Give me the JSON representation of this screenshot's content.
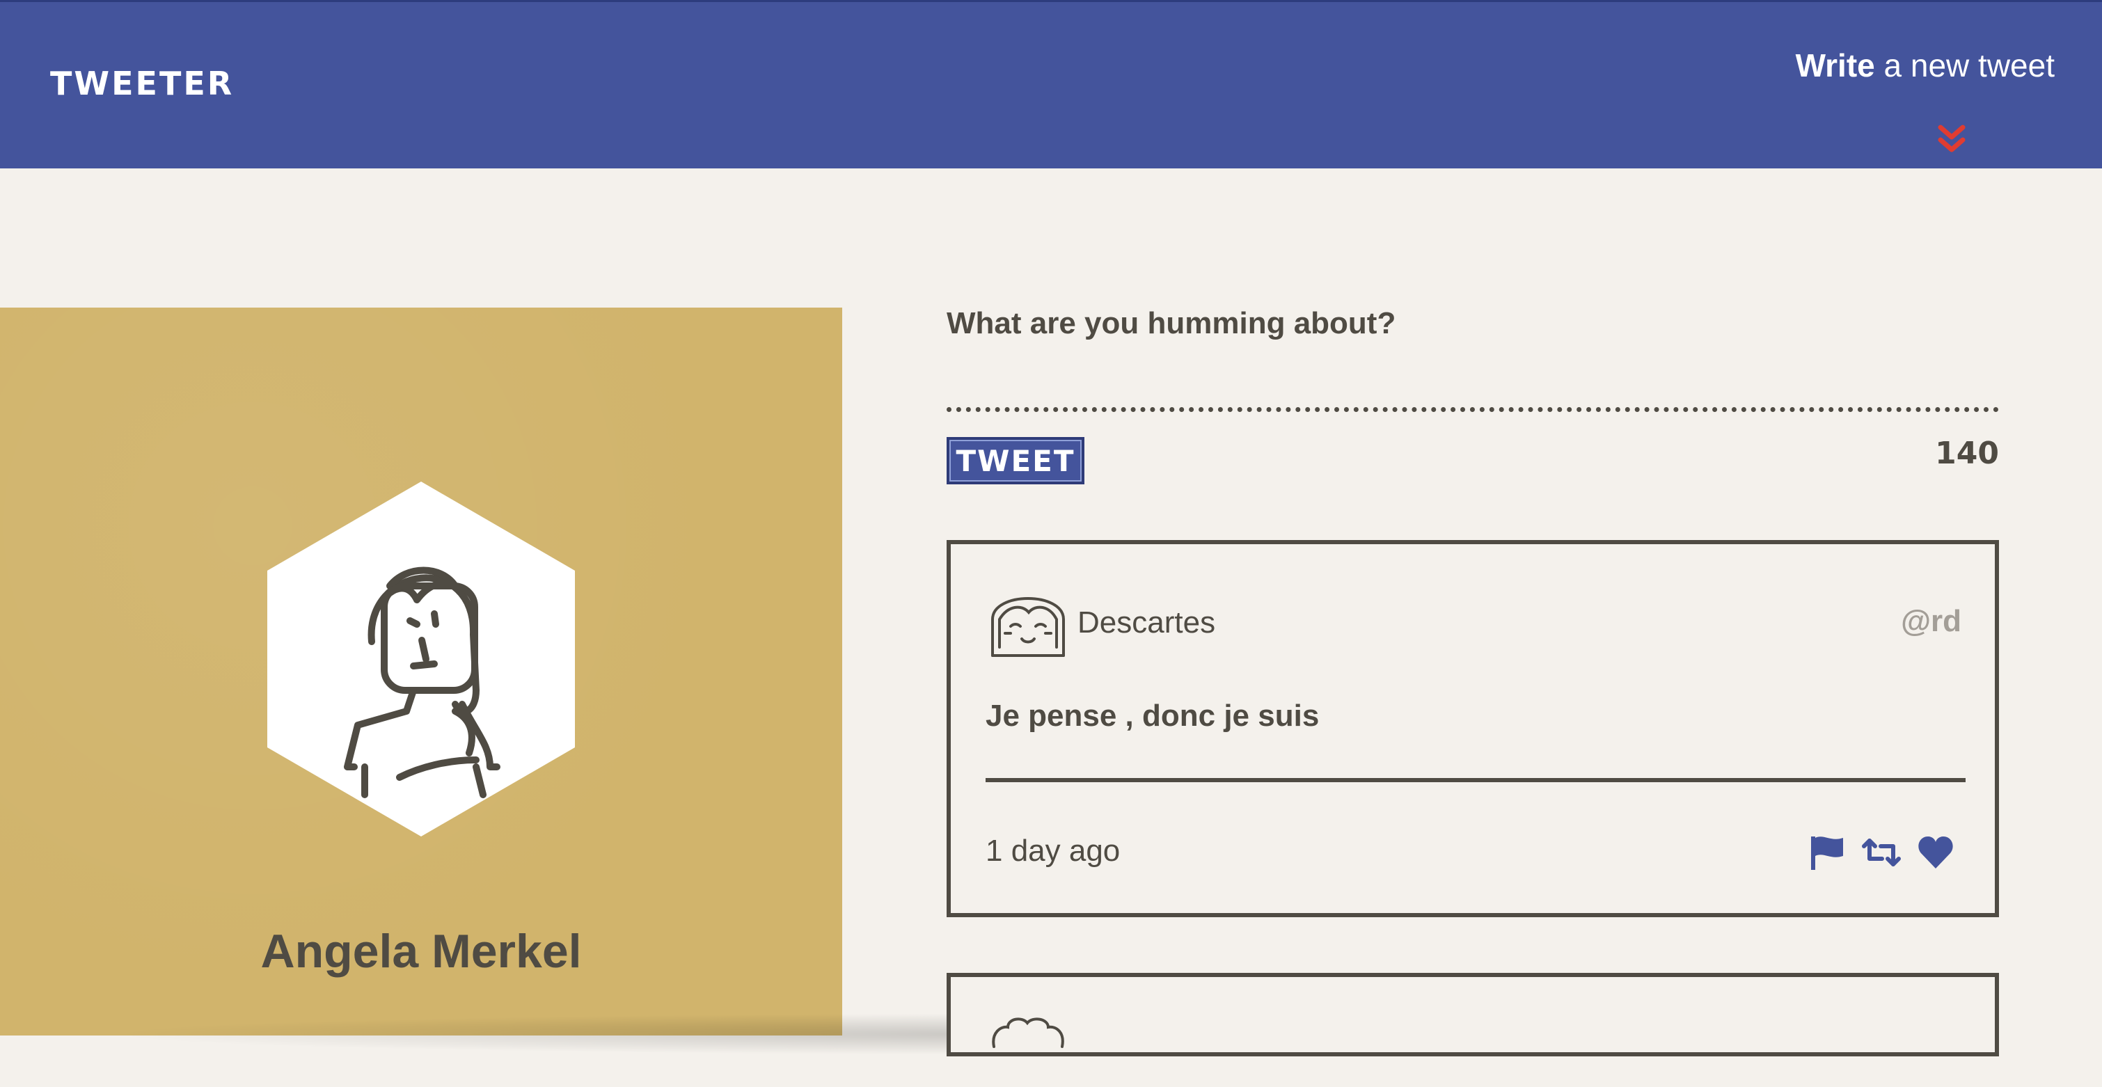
{
  "nav": {
    "brand": "TWEETER",
    "compose_bold": "Write",
    "compose_rest": " a new tweet",
    "chevron_icon": "double-chevron-down-icon",
    "chevron_color": "#e03c31"
  },
  "profile": {
    "name": "Angela Merkel",
    "avatar_icon": "woman-avatar-icon",
    "panel_color": "#d1b46c"
  },
  "compose": {
    "label": "What are you humming about?",
    "placeholder": "",
    "button_label": "TWEET",
    "counter": "140"
  },
  "tweets": [
    {
      "author": "Descartes",
      "handle": "@rd",
      "text": "Je pense , donc je suis",
      "time": "1 day ago",
      "avatar_icon": "girl-avatar-icon",
      "actions": [
        "flag-icon",
        "retweet-icon",
        "heart-icon"
      ]
    },
    {
      "avatar_icon": "curly-avatar-icon"
    }
  ],
  "colors": {
    "navbar": "#44549c",
    "background": "#f4f1ec",
    "text": "#4f4b43",
    "accent": "#44549c"
  }
}
